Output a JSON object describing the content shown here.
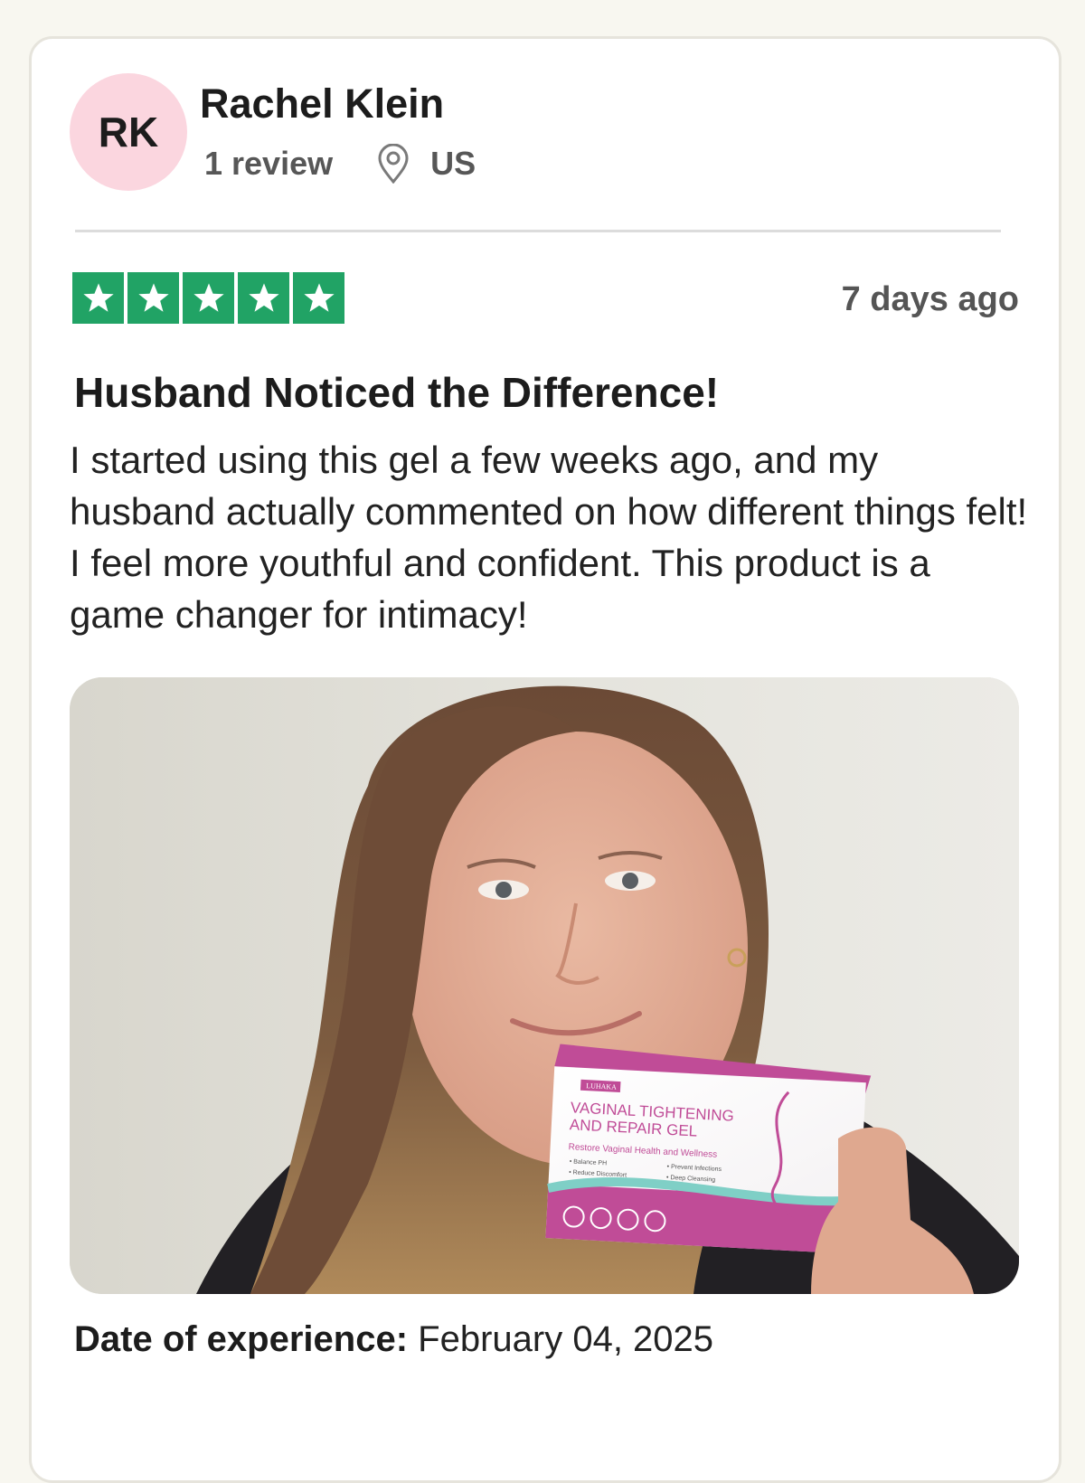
{
  "reviewer": {
    "initials": "RK",
    "name": "Rachel Klein",
    "review_count": "1 review",
    "location": "US",
    "avatar_color": "#fbd6df"
  },
  "review": {
    "rating": 5,
    "rating_max": 5,
    "star_color": "#21a365",
    "posted": "7 days ago",
    "title": "Husband Noticed the Difference!",
    "body": "I started using this gel a few weeks ago, and my husband actually commented on how different things felt! I feel more youthful and confident. This product is a game changer for intimacy!",
    "experience_label": "Date of experience:",
    "experience_date": "February 04, 2025"
  },
  "product_box": {
    "brand": "LUHAKA",
    "name_line1": "VAGINAL TIGHTENING",
    "name_line2": "AND REPAIR GEL",
    "tagline": "Restore Vaginal Health and Wellness",
    "benefits": [
      "Balance PH",
      "Reduce Discomfort",
      "Prevent Infections",
      "Deep Cleansing"
    ]
  },
  "icons": [
    "location-pin-icon",
    "star-icon"
  ]
}
